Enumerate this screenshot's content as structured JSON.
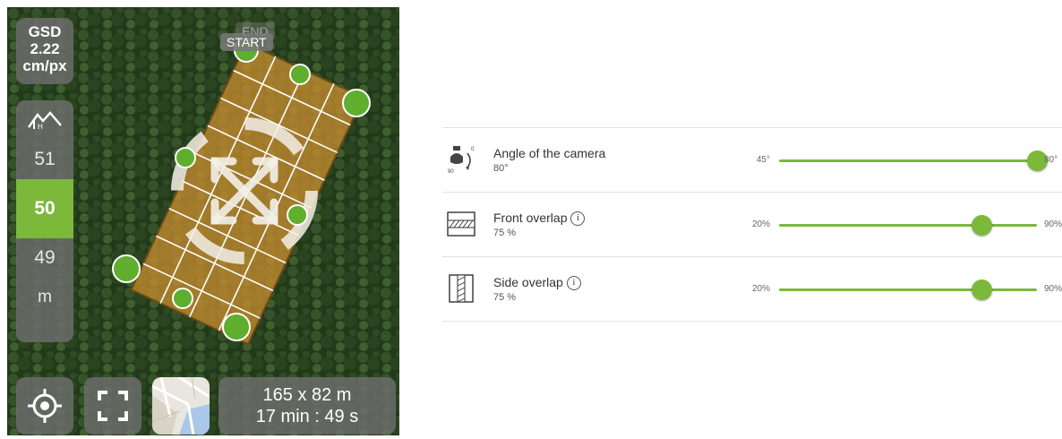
{
  "map": {
    "gsd": {
      "line1": "GSD",
      "line2": "2.22",
      "line3": "cm/px"
    },
    "altitude": {
      "values": [
        "51",
        "50",
        "49"
      ],
      "selected": "50",
      "unit": "m"
    },
    "tags": {
      "start": "START",
      "end": "END"
    },
    "stats": {
      "dimensions": "165 x 82 m",
      "duration": "17 min : 49 s"
    },
    "icons": {
      "altitude": "terrain-height-icon",
      "locate": "locate-icon",
      "expand": "expand-icon",
      "maptype": "map-type-thumbnail",
      "rotate": "rotate-arrows-icon",
      "move": "move-arrows-icon"
    },
    "colors": {
      "accent": "#7cb83a",
      "polygon": "#c48a2e",
      "handle": "#5fae2e"
    }
  },
  "settings": [
    {
      "title": "Angle of the camera",
      "value": "80°",
      "min": "45°",
      "max": "80°",
      "position": 1.0,
      "icon": "camera-angle-icon",
      "icon_label": "90",
      "has_info": false
    },
    {
      "title": "Front overlap",
      "value": "75 %",
      "min": "20%",
      "max": "90%",
      "position": 0.7857,
      "icon": "front-overlap-icon",
      "has_info": true
    },
    {
      "title": "Side overlap",
      "value": "75 %",
      "min": "20%",
      "max": "90%",
      "position": 0.7857,
      "icon": "side-overlap-icon",
      "has_info": true
    }
  ],
  "info_glyph": "i"
}
